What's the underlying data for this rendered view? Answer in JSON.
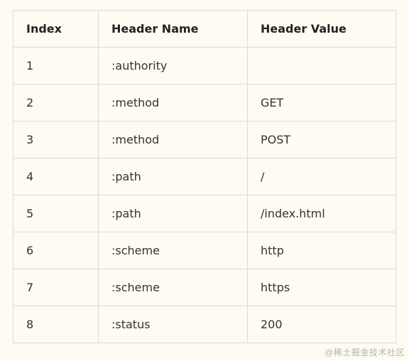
{
  "table": {
    "columns": [
      "Index",
      "Header Name",
      "Header Value"
    ],
    "rows": [
      {
        "index": "1",
        "name": ":authority",
        "value": ""
      },
      {
        "index": "2",
        "name": ":method",
        "value": "GET"
      },
      {
        "index": "3",
        "name": ":method",
        "value": "POST"
      },
      {
        "index": "4",
        "name": ":path",
        "value": "/"
      },
      {
        "index": "5",
        "name": ":path",
        "value": "/index.html"
      },
      {
        "index": "6",
        "name": ":scheme",
        "value": "http"
      },
      {
        "index": "7",
        "name": ":scheme",
        "value": "https"
      },
      {
        "index": "8",
        "name": ":status",
        "value": "200"
      }
    ]
  },
  "watermark": "@稀土掘金技术社区"
}
